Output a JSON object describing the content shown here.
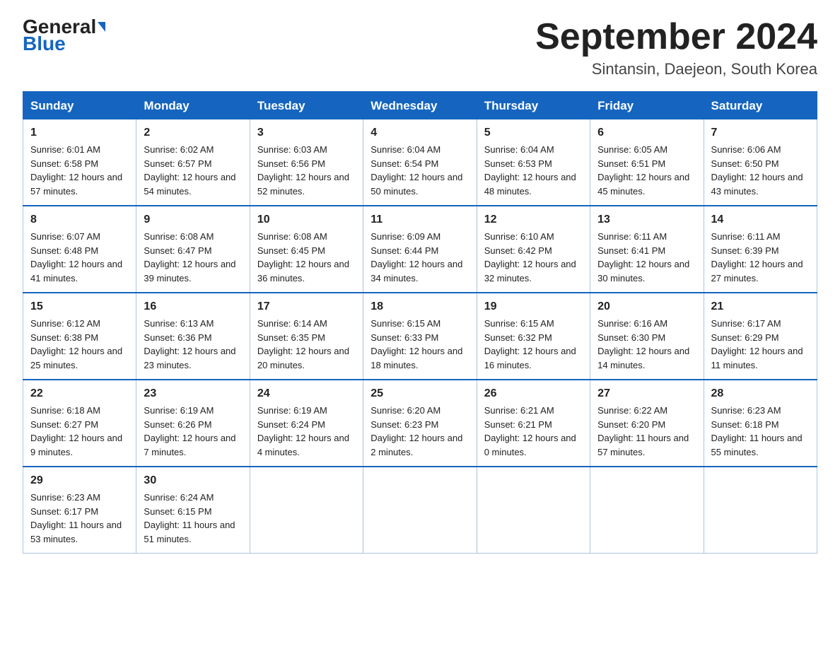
{
  "logo": {
    "general": "General",
    "blue": "Blue"
  },
  "title": {
    "month": "September 2024",
    "location": "Sintansin, Daejeon, South Korea"
  },
  "days": [
    "Sunday",
    "Monday",
    "Tuesday",
    "Wednesday",
    "Thursday",
    "Friday",
    "Saturday"
  ],
  "weeks": [
    [
      {
        "day": 1,
        "sunrise": "6:01 AM",
        "sunset": "6:58 PM",
        "daylight": "12 hours and 57 minutes."
      },
      {
        "day": 2,
        "sunrise": "6:02 AM",
        "sunset": "6:57 PM",
        "daylight": "12 hours and 54 minutes."
      },
      {
        "day": 3,
        "sunrise": "6:03 AM",
        "sunset": "6:56 PM",
        "daylight": "12 hours and 52 minutes."
      },
      {
        "day": 4,
        "sunrise": "6:04 AM",
        "sunset": "6:54 PM",
        "daylight": "12 hours and 50 minutes."
      },
      {
        "day": 5,
        "sunrise": "6:04 AM",
        "sunset": "6:53 PM",
        "daylight": "12 hours and 48 minutes."
      },
      {
        "day": 6,
        "sunrise": "6:05 AM",
        "sunset": "6:51 PM",
        "daylight": "12 hours and 45 minutes."
      },
      {
        "day": 7,
        "sunrise": "6:06 AM",
        "sunset": "6:50 PM",
        "daylight": "12 hours and 43 minutes."
      }
    ],
    [
      {
        "day": 8,
        "sunrise": "6:07 AM",
        "sunset": "6:48 PM",
        "daylight": "12 hours and 41 minutes."
      },
      {
        "day": 9,
        "sunrise": "6:08 AM",
        "sunset": "6:47 PM",
        "daylight": "12 hours and 39 minutes."
      },
      {
        "day": 10,
        "sunrise": "6:08 AM",
        "sunset": "6:45 PM",
        "daylight": "12 hours and 36 minutes."
      },
      {
        "day": 11,
        "sunrise": "6:09 AM",
        "sunset": "6:44 PM",
        "daylight": "12 hours and 34 minutes."
      },
      {
        "day": 12,
        "sunrise": "6:10 AM",
        "sunset": "6:42 PM",
        "daylight": "12 hours and 32 minutes."
      },
      {
        "day": 13,
        "sunrise": "6:11 AM",
        "sunset": "6:41 PM",
        "daylight": "12 hours and 30 minutes."
      },
      {
        "day": 14,
        "sunrise": "6:11 AM",
        "sunset": "6:39 PM",
        "daylight": "12 hours and 27 minutes."
      }
    ],
    [
      {
        "day": 15,
        "sunrise": "6:12 AM",
        "sunset": "6:38 PM",
        "daylight": "12 hours and 25 minutes."
      },
      {
        "day": 16,
        "sunrise": "6:13 AM",
        "sunset": "6:36 PM",
        "daylight": "12 hours and 23 minutes."
      },
      {
        "day": 17,
        "sunrise": "6:14 AM",
        "sunset": "6:35 PM",
        "daylight": "12 hours and 20 minutes."
      },
      {
        "day": 18,
        "sunrise": "6:15 AM",
        "sunset": "6:33 PM",
        "daylight": "12 hours and 18 minutes."
      },
      {
        "day": 19,
        "sunrise": "6:15 AM",
        "sunset": "6:32 PM",
        "daylight": "12 hours and 16 minutes."
      },
      {
        "day": 20,
        "sunrise": "6:16 AM",
        "sunset": "6:30 PM",
        "daylight": "12 hours and 14 minutes."
      },
      {
        "day": 21,
        "sunrise": "6:17 AM",
        "sunset": "6:29 PM",
        "daylight": "12 hours and 11 minutes."
      }
    ],
    [
      {
        "day": 22,
        "sunrise": "6:18 AM",
        "sunset": "6:27 PM",
        "daylight": "12 hours and 9 minutes."
      },
      {
        "day": 23,
        "sunrise": "6:19 AM",
        "sunset": "6:26 PM",
        "daylight": "12 hours and 7 minutes."
      },
      {
        "day": 24,
        "sunrise": "6:19 AM",
        "sunset": "6:24 PM",
        "daylight": "12 hours and 4 minutes."
      },
      {
        "day": 25,
        "sunrise": "6:20 AM",
        "sunset": "6:23 PM",
        "daylight": "12 hours and 2 minutes."
      },
      {
        "day": 26,
        "sunrise": "6:21 AM",
        "sunset": "6:21 PM",
        "daylight": "12 hours and 0 minutes."
      },
      {
        "day": 27,
        "sunrise": "6:22 AM",
        "sunset": "6:20 PM",
        "daylight": "11 hours and 57 minutes."
      },
      {
        "day": 28,
        "sunrise": "6:23 AM",
        "sunset": "6:18 PM",
        "daylight": "11 hours and 55 minutes."
      }
    ],
    [
      {
        "day": 29,
        "sunrise": "6:23 AM",
        "sunset": "6:17 PM",
        "daylight": "11 hours and 53 minutes."
      },
      {
        "day": 30,
        "sunrise": "6:24 AM",
        "sunset": "6:15 PM",
        "daylight": "11 hours and 51 minutes."
      },
      null,
      null,
      null,
      null,
      null
    ]
  ],
  "labels": {
    "sunrise": "Sunrise:",
    "sunset": "Sunset:",
    "daylight": "Daylight:"
  }
}
